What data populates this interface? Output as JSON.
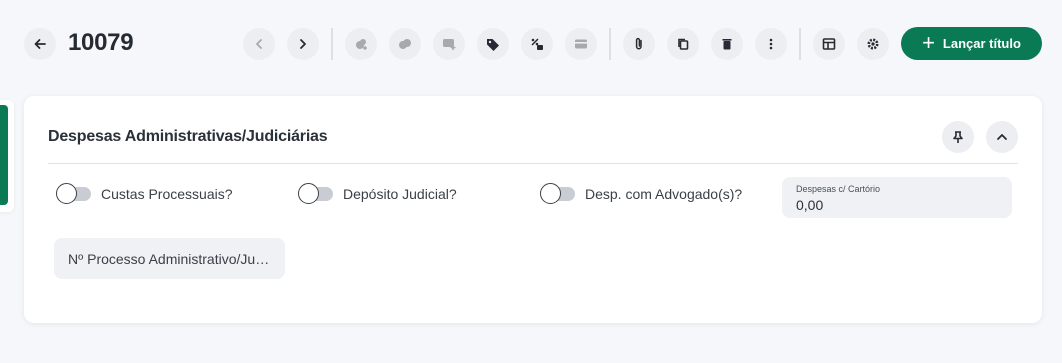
{
  "header": {
    "record_id": "10079",
    "primary_action_label": "Lançar título"
  },
  "toolbar_icons": [
    {
      "name": "back-icon"
    },
    {
      "name": "prev-icon",
      "disabled": true
    },
    {
      "name": "next-icon"
    },
    {
      "name": "coins-in-icon",
      "disabled": true
    },
    {
      "name": "coins-icon",
      "disabled": true
    },
    {
      "name": "card-add-icon",
      "disabled": true
    },
    {
      "name": "tag-icon"
    },
    {
      "name": "discount-icon"
    },
    {
      "name": "credit-card-icon",
      "disabled": true
    },
    {
      "name": "attachment-icon"
    },
    {
      "name": "copy-icon"
    },
    {
      "name": "delete-icon"
    },
    {
      "name": "more-vertical-icon"
    },
    {
      "name": "layout-icon"
    },
    {
      "name": "settings-icon"
    }
  ],
  "section": {
    "title": "Despesas Administrativas/Judiciárias",
    "toggles": [
      {
        "label": "Custas Processuais?",
        "on": false
      },
      {
        "label": "Depósito Judicial?",
        "on": false
      },
      {
        "label": "Desp. com Advogado(s)?",
        "on": false
      }
    ],
    "cartorio_field": {
      "label": "Despesas c/ Cartório",
      "value": "0,00"
    },
    "processo_field": {
      "placeholder": "Nº Processo Administrativo/Judicial"
    }
  },
  "colors": {
    "accent": "#0a7a55",
    "background": "#f6f7fb",
    "card": "#ffffff",
    "chip": "#eceef2"
  }
}
